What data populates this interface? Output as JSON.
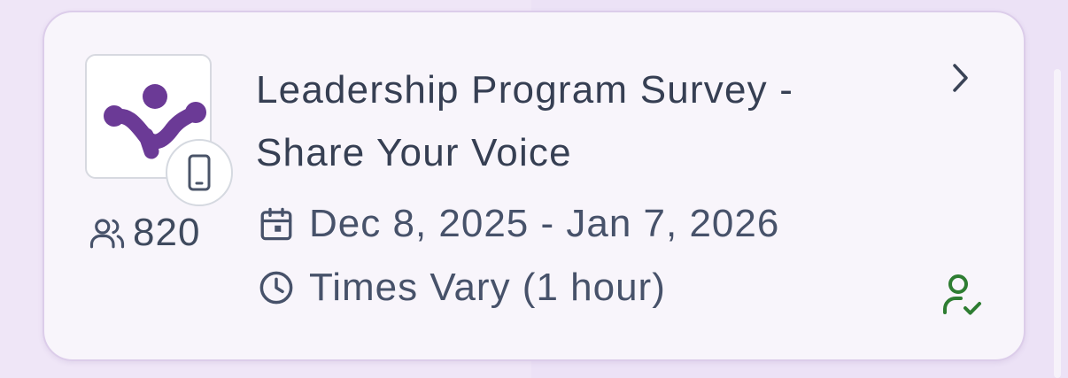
{
  "event": {
    "title": "Leadership Program Survey - Share Your Voice",
    "attendee_count": "820",
    "date_range": "Dec 8, 2025 - Jan 7, 2026",
    "time": "Times Vary (1 hour)"
  },
  "icons": {
    "logo": "purple-organization-logo",
    "badge": "mobile-phone-icon",
    "attendees": "users-icon",
    "date": "calendar-icon",
    "time": "clock-icon",
    "open": "chevron-right-icon",
    "status": "user-check-icon"
  },
  "colors": {
    "logo_purple": "#6b3a96",
    "status_green": "#2e7d32",
    "text_primary": "#363f53",
    "text_secondary": "#47526a"
  }
}
